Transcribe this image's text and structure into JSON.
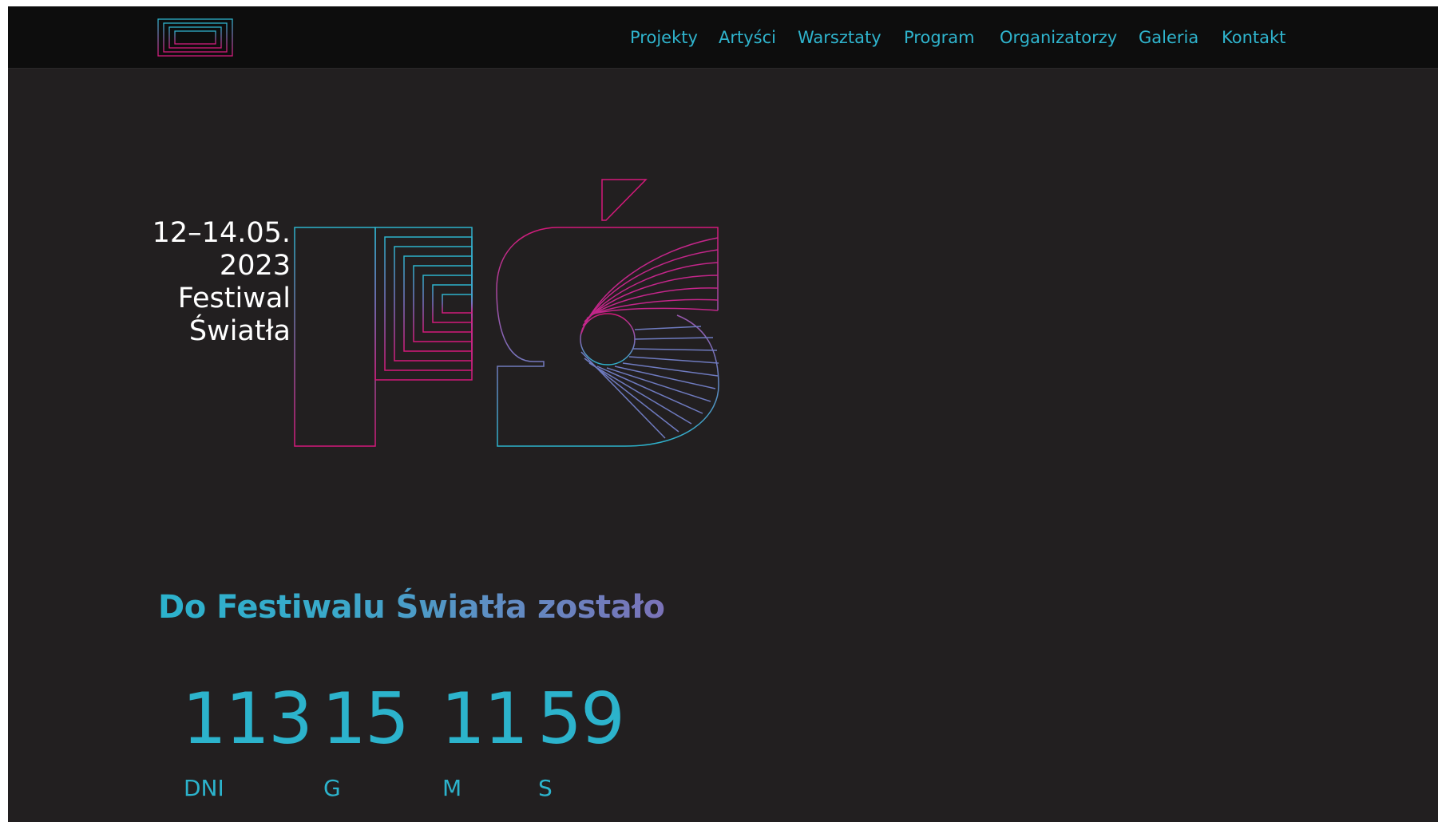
{
  "colors": {
    "background": "#221f20",
    "navbar": "#0d0d0d",
    "accent_cyan": "#2cb3cc",
    "accent_magenta": "#d4197a",
    "accent_purple": "#7b72b8",
    "text_white": "#ffffff"
  },
  "header": {
    "logo_icon": "nested-rectangles-logo-icon",
    "nav": [
      {
        "label": "Projekty"
      },
      {
        "label": "Artyści"
      },
      {
        "label": "Warsztaty"
      },
      {
        "label": "Program"
      },
      {
        "label": "Organizatorzy"
      },
      {
        "label": "Galeria"
      },
      {
        "label": "Kontakt"
      }
    ]
  },
  "hero": {
    "lines": [
      "12–14.05.",
      "2023",
      "Festiwal",
      "Światła"
    ],
    "mark_icon": "fs-festival-mark-icon"
  },
  "countdown": {
    "heading": "Do Festiwalu Światła zostało",
    "items": [
      {
        "value": "113",
        "unit": "DNI"
      },
      {
        "value": "15",
        "unit": "G"
      },
      {
        "value": "11",
        "unit": "M"
      },
      {
        "value": "59",
        "unit": "S"
      }
    ]
  }
}
